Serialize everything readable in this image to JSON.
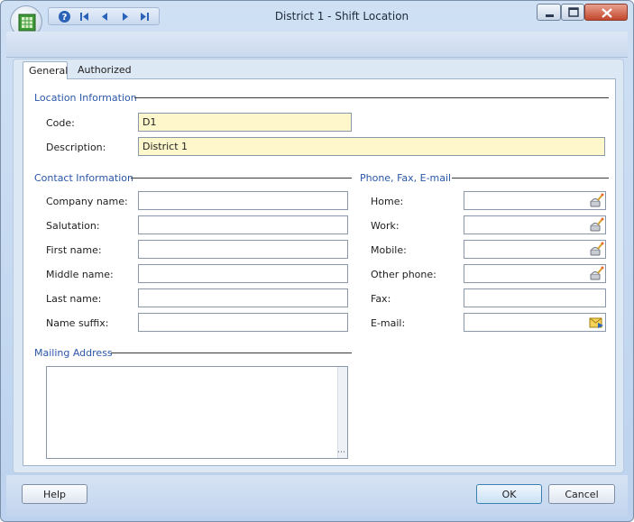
{
  "window": {
    "title": "District 1 - Shift Location"
  },
  "tabs": [
    {
      "label": "General",
      "active": true
    },
    {
      "label": "Authorized Employees",
      "active": false
    }
  ],
  "location_info": {
    "title": "Location Information",
    "code": {
      "label": "Code:",
      "value": "D1"
    },
    "description": {
      "label": "Description:",
      "value": "District 1"
    }
  },
  "contact_info": {
    "title": "Contact Information",
    "fields": [
      {
        "label": "Company name:",
        "value": ""
      },
      {
        "label": "Salutation:",
        "value": ""
      },
      {
        "label": "First name:",
        "value": ""
      },
      {
        "label": "Middle name:",
        "value": ""
      },
      {
        "label": "Last name:",
        "value": ""
      },
      {
        "label": "Name suffix:",
        "value": ""
      }
    ]
  },
  "phone_info": {
    "title": "Phone, Fax, E-mail",
    "fields": [
      {
        "label": "Home:",
        "value": "",
        "icon": "phone-dial-icon"
      },
      {
        "label": "Work:",
        "value": "",
        "icon": "phone-dial-icon"
      },
      {
        "label": "Mobile:",
        "value": "",
        "icon": "phone-dial-icon"
      },
      {
        "label": "Other phone:",
        "value": "",
        "icon": "phone-dial-icon"
      },
      {
        "label": "Fax:",
        "value": ""
      },
      {
        "label": "E-mail:",
        "value": "",
        "icon": "send-email-icon"
      }
    ]
  },
  "mailing": {
    "title": "Mailing Address",
    "value": ""
  },
  "buttons": {
    "help": "Help",
    "ok": "OK",
    "cancel": "Cancel"
  },
  "colors": {
    "required_field": "#fff7cc",
    "section_title": "#2a57a8"
  }
}
